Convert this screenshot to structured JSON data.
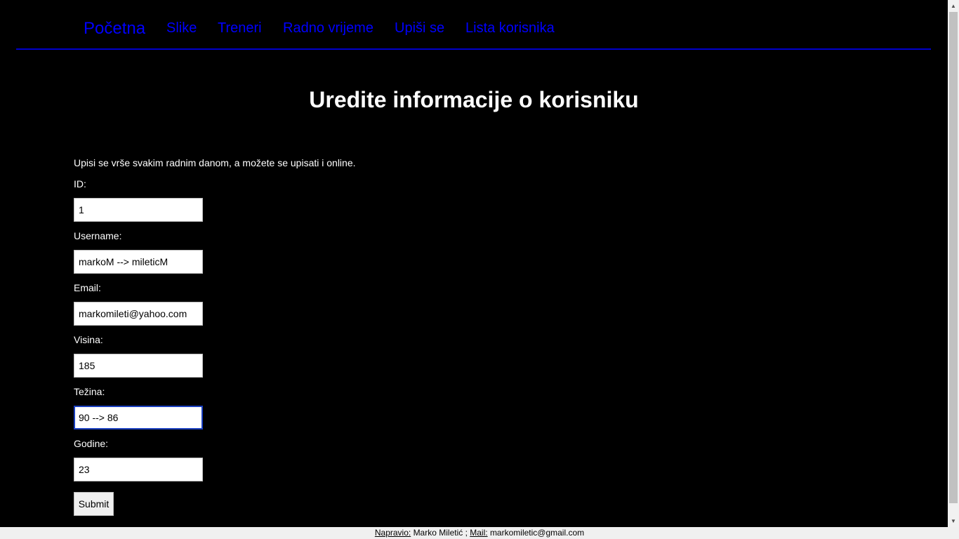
{
  "nav": {
    "items": [
      {
        "label": "Početna"
      },
      {
        "label": "Slike"
      },
      {
        "label": "Treneri"
      },
      {
        "label": "Radno vrijeme"
      },
      {
        "label": "Upiši se"
      },
      {
        "label": "Lista korisnika"
      }
    ]
  },
  "page_title": "Uredite informacije o korisniku",
  "intro_text": "Upisi se vrše svakim radnim danom, a možete se upisati i online.",
  "form": {
    "fields": [
      {
        "label": "ID:",
        "value": "1"
      },
      {
        "label": "Username:",
        "value": "markoM --> mileticM"
      },
      {
        "label": "Email:",
        "value": "markomileti@yahoo.com"
      },
      {
        "label": "Visina:",
        "value": "185"
      },
      {
        "label": "Težina:",
        "value": "90 --> 86"
      },
      {
        "label": "Godine:",
        "value": "23"
      }
    ],
    "submit_label": "Submit"
  },
  "footer": {
    "author_label": "Napravio:",
    "author_name": "Marko Miletić ;",
    "mail_label": "Mail:",
    "mail_value": "markomiletic@gmail.com"
  },
  "colors": {
    "background": "#000000",
    "nav_link": "#0000ff",
    "nav_border": "#0000cc",
    "text": "#ffffff",
    "footer_bg": "#f0f0f0"
  }
}
